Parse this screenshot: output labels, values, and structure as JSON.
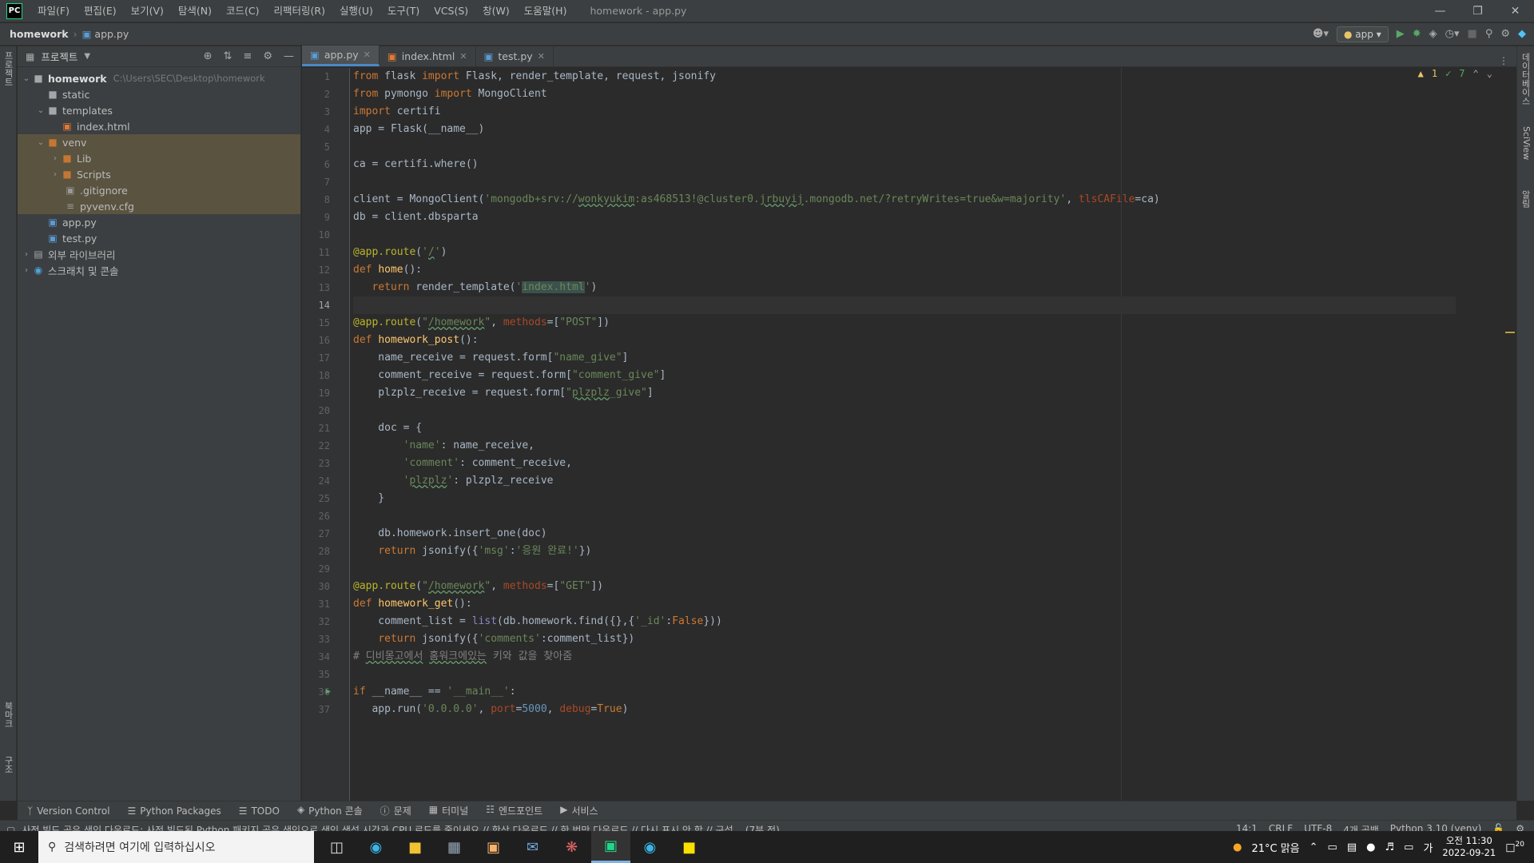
{
  "menubar": {
    "logo": "PC",
    "items": [
      "파일(F)",
      "편집(E)",
      "보기(V)",
      "탐색(N)",
      "코드(C)",
      "리팩터링(R)",
      "실행(U)",
      "도구(T)",
      "VCS(S)",
      "창(W)",
      "도움말(H)"
    ],
    "window_title": "homework - app.py"
  },
  "navbar": {
    "project": "homework",
    "file": "app.py",
    "run_config": "app"
  },
  "left_strip": {
    "top_label": "프로젝트",
    "bottom_label1": "북마크",
    "bottom_label2": "구조"
  },
  "right_strip": {
    "label1": "데이터베이스",
    "label2": "SciView",
    "label3": "알림"
  },
  "project_panel": {
    "title": "프로젝트",
    "tree": [
      {
        "label": "homework",
        "path": "C:\\Users\\SEC\\Desktop\\homework"
      },
      {
        "label": "static"
      },
      {
        "label": "templates"
      },
      {
        "label": "index.html"
      },
      {
        "label": "venv"
      },
      {
        "label": "Lib"
      },
      {
        "label": "Scripts"
      },
      {
        "label": ".gitignore"
      },
      {
        "label": "pyvenv.cfg"
      },
      {
        "label": "app.py"
      },
      {
        "label": "test.py"
      },
      {
        "label": "외부 라이브러리"
      },
      {
        "label": "스크래치 및 콘솔"
      }
    ]
  },
  "tabs": [
    "app.py",
    "index.html",
    "test.py"
  ],
  "inspections": {
    "warnings": "1",
    "ok": "7"
  },
  "editor": {
    "current_line": 14,
    "line_numbers": [
      "1",
      "2",
      "3",
      "4",
      "5",
      "6",
      "7",
      "8",
      "9",
      "10",
      "11",
      "12",
      "13",
      "14",
      "15",
      "16",
      "17",
      "18",
      "19",
      "20",
      "21",
      "22",
      "23",
      "24",
      "25",
      "26",
      "27",
      "28",
      "29",
      "30",
      "31",
      "32",
      "33",
      "34",
      "35",
      "36",
      "37"
    ]
  },
  "tool_windows": [
    "Version Control",
    "Python Packages",
    "TODO",
    "Python 콘솔",
    "문제",
    "터미널",
    "엔드포인트",
    "서비스"
  ],
  "statusbar": {
    "message": "사전 빌드 공유 색인 다운로드: 사전 빌드된 Python 패키지 공유 색인으로 색인 생성 시간과 CPU 로드를 줄이세요 // 항상 다운로드 // 한 번만 다운로드 // 다시 표시 안 함 // 구성... (7분 전)",
    "position": "14:1",
    "line_sep": "CRLF",
    "encoding": "UTF-8",
    "indent": "4개 공백",
    "interpreter": "Python 3.10 (venv)"
  },
  "taskbar": {
    "search_placeholder": "검색하려면 여기에 입력하십시오",
    "weather": "21°C 맑음",
    "ime": "가",
    "time": "오전 11:30",
    "date": "2022-09-21",
    "notifications": "20"
  }
}
